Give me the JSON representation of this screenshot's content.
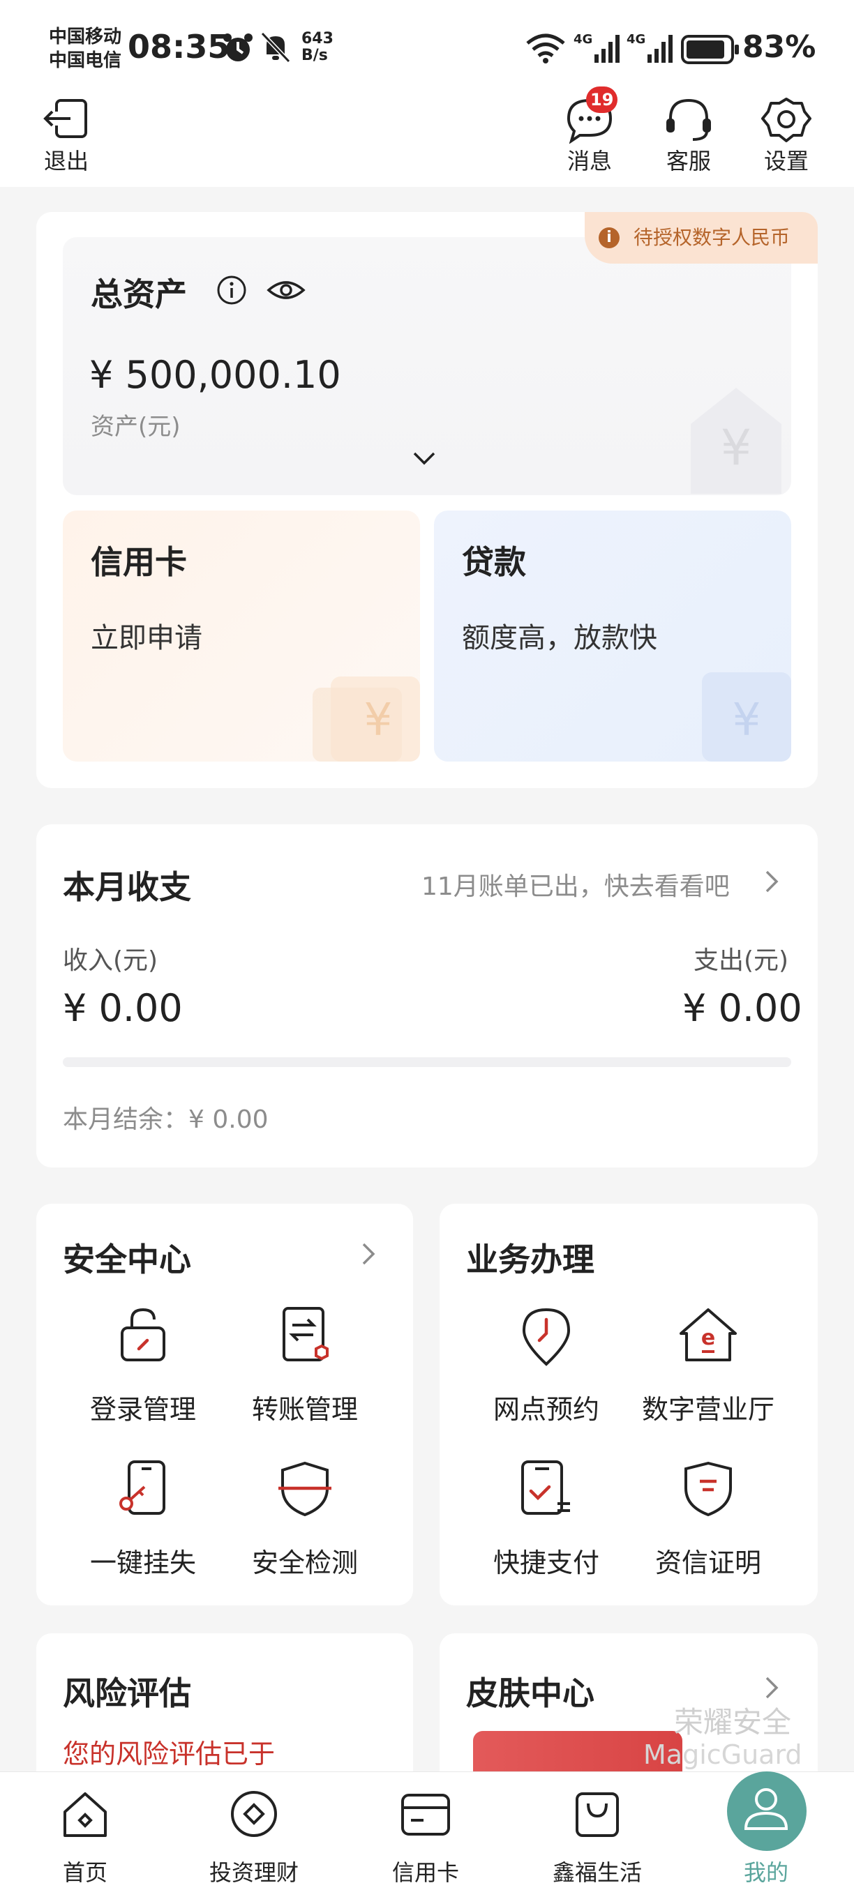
{
  "status_bar": {
    "carrier_1": "中国移动",
    "carrier_2": "中国电信",
    "time": "08:35",
    "speed_value": "643",
    "speed_unit": "B/s",
    "battery": "83%"
  },
  "header": {
    "exit_label": "退出",
    "messages_label": "消息",
    "messages_badge": "19",
    "service_label": "客服",
    "settings_label": "设置"
  },
  "assets": {
    "title": "总资产",
    "amount": "¥ 500,000.10",
    "unit_label": "资产(元)",
    "auth_tag": "待授权数字人民币",
    "credit_card": {
      "title": "信用卡",
      "desc": "立即申请"
    },
    "loan": {
      "title": "贷款",
      "desc": "额度高，放款快"
    }
  },
  "monthly": {
    "title": "本月收支",
    "bill_link": "11月账单已出，快去看看吧",
    "income_label": "收入(元)",
    "income_value": "¥ 0.00",
    "expense_label": "支出(元)",
    "expense_value": "¥ 0.00",
    "balance": "本月结余：¥ 0.00"
  },
  "security_center": {
    "title": "安全中心",
    "items": [
      {
        "label": "登录管理",
        "icon": "lock-icon"
      },
      {
        "label": "转账管理",
        "icon": "transfer-doc-icon"
      },
      {
        "label": "一键挂失",
        "icon": "phone-key-icon"
      },
      {
        "label": "安全检测",
        "icon": "shield-scan-icon"
      }
    ]
  },
  "business": {
    "title": "业务办理",
    "items": [
      {
        "label": "网点预约",
        "icon": "location-clock-icon"
      },
      {
        "label": "数字营业厅",
        "icon": "house-e-icon"
      },
      {
        "label": "快捷支付",
        "icon": "doc-check-icon"
      },
      {
        "label": "资信证明",
        "icon": "badge-shield-icon"
      }
    ]
  },
  "risk": {
    "title": "风险评估",
    "notice": "您的风险评估已于"
  },
  "skin": {
    "title": "皮肤中心",
    "watermark_1": "荣耀安全",
    "watermark_2": "MagicGuard"
  },
  "bottom_nav": [
    {
      "label": "首页",
      "icon": "home-icon"
    },
    {
      "label": "投资理财",
      "icon": "invest-icon"
    },
    {
      "label": "信用卡",
      "icon": "credit-card-icon"
    },
    {
      "label": "鑫福生活",
      "icon": "shopping-bag-icon"
    },
    {
      "label": "我的",
      "icon": "user-icon",
      "active": true
    }
  ],
  "colors": {
    "accent_red": "#c8322b",
    "active_teal": "#5aa59c",
    "tag_bg": "#fbe3d2",
    "tag_text": "#b5642a"
  }
}
